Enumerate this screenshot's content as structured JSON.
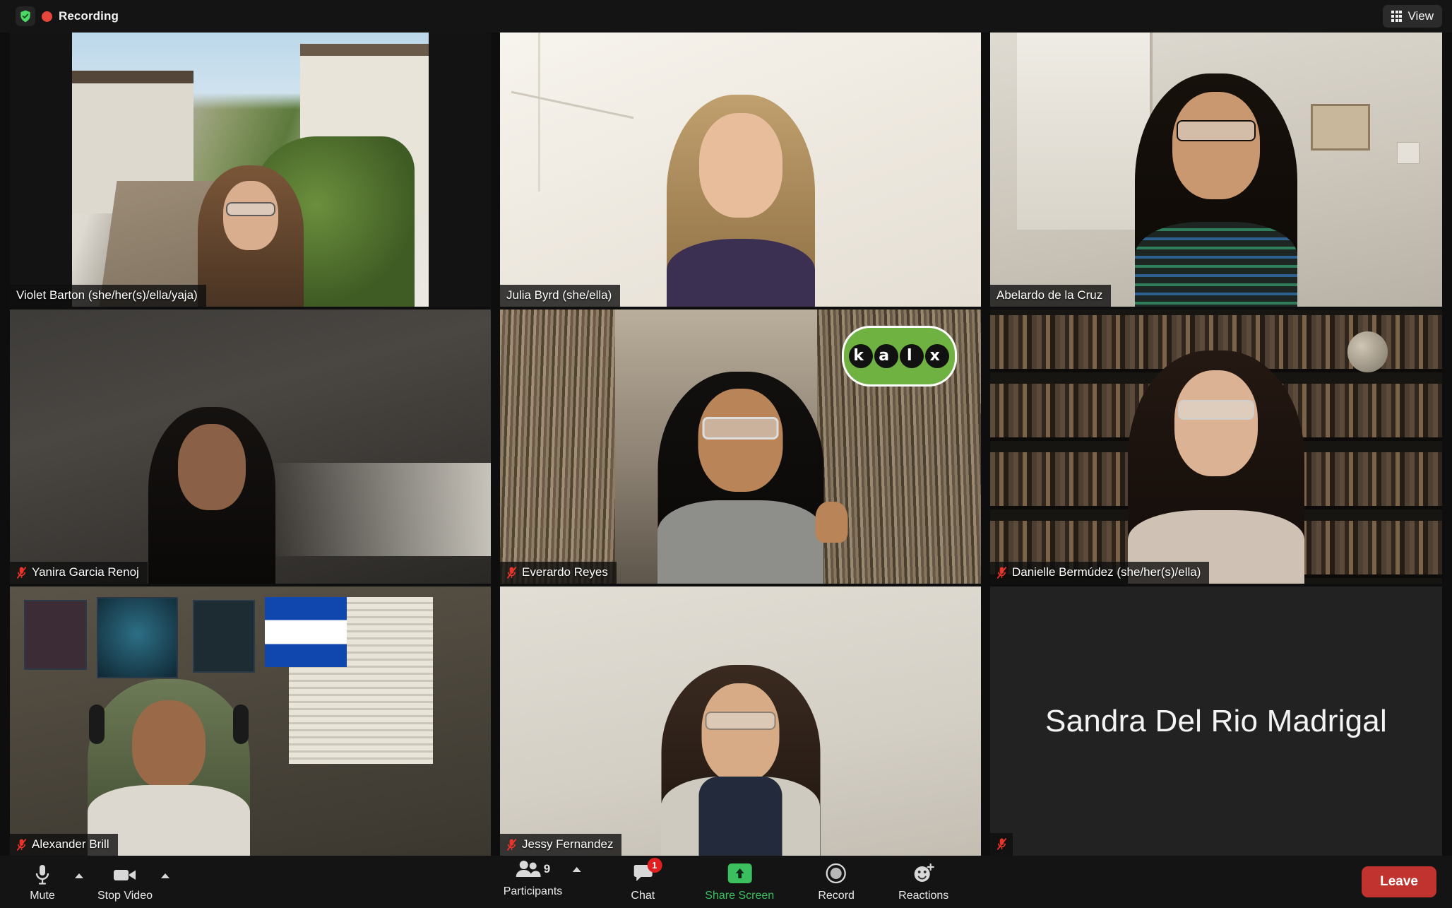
{
  "topbar": {
    "recording_label": "Recording",
    "shield_icon": "shield-check-icon",
    "record_dot_icon": "record-dot-icon",
    "view_label": "View",
    "view_icon": "grid-view-icon",
    "recording_dot_color": "#e8453c",
    "shield_color": "#4cd964"
  },
  "gallery": {
    "speaking_border_color": "#cfe84c",
    "participants": [
      {
        "name": "Violet Barton (she/her(s)/ella/yaja)",
        "muted": false,
        "speaking": false,
        "video": true,
        "scene": "colonial-street"
      },
      {
        "name": "Julia Byrd (she/ella)",
        "muted": false,
        "speaking": true,
        "video": true,
        "scene": "bright-room"
      },
      {
        "name": "Abelardo de la Cruz",
        "muted": false,
        "speaking": false,
        "video": true,
        "scene": "office-room"
      },
      {
        "name": "Yanira Garcia Renoj",
        "muted": true,
        "speaking": false,
        "video": true,
        "scene": "dim-room"
      },
      {
        "name": "Everardo Reyes",
        "muted": true,
        "speaking": false,
        "video": true,
        "scene": "record-store"
      },
      {
        "name": "Danielle Bermúdez (she/her(s)/ella)",
        "muted": true,
        "speaking": false,
        "video": true,
        "scene": "bookshelf"
      },
      {
        "name": "Alexander Brill",
        "muted": true,
        "speaking": false,
        "video": true,
        "scene": "dorm-room"
      },
      {
        "name": "Jessy Fernandez",
        "muted": true,
        "speaking": false,
        "video": true,
        "scene": "plain-room"
      },
      {
        "name": "Sandra Del Rio Madrigal",
        "muted": true,
        "speaking": false,
        "video": false,
        "scene": "no-video"
      }
    ]
  },
  "toolbar": {
    "mute_label": "Mute",
    "mute_icon": "microphone-icon",
    "stop_video_label": "Stop Video",
    "stop_video_icon": "video-camera-icon",
    "participants_label": "Participants",
    "participants_icon": "people-icon",
    "participants_count": "9",
    "chat_label": "Chat",
    "chat_icon": "chat-bubble-icon",
    "chat_badge": "1",
    "share_screen_label": "Share Screen",
    "share_screen_icon": "share-arrow-up-icon",
    "share_screen_color": "#3bbf5f",
    "record_label": "Record",
    "record_icon": "record-circle-icon",
    "reactions_label": "Reactions",
    "reactions_icon": "smiley-plus-icon",
    "leave_label": "Leave",
    "leave_color": "#c0332e"
  }
}
